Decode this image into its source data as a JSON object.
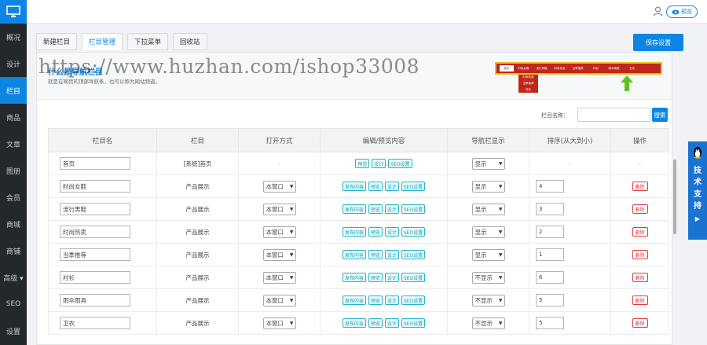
{
  "sidebar": {
    "logo_icon": "monitor-icon",
    "items": [
      {
        "label": "概况",
        "active": false
      },
      {
        "label": "设计",
        "active": false
      },
      {
        "label": "栏目",
        "active": true
      },
      {
        "label": "商品",
        "active": false
      },
      {
        "label": "文章",
        "active": false
      },
      {
        "label": "图册",
        "active": false
      },
      {
        "label": "会员",
        "active": false
      },
      {
        "label": "商城",
        "active": false
      },
      {
        "label": "商铺",
        "active": false
      },
      {
        "label": "高级 ▾",
        "active": false
      },
      {
        "label": "SEO",
        "active": false
      },
      {
        "label": "设置",
        "active": false
      }
    ]
  },
  "topbar": {
    "user_icon": "user-icon",
    "preview_label": "预览"
  },
  "tabs": [
    {
      "label": "新建栏目",
      "active": false
    },
    {
      "label": "栏目管理",
      "active": true
    },
    {
      "label": "下拉菜单",
      "active": false
    },
    {
      "label": "回收站",
      "active": false
    }
  ],
  "save_label": "保存设置",
  "info": {
    "title": "什么是导航栏目",
    "desc": "就是在网页的顶部导航条，也可以称为网站频道。",
    "watermark": "https://www.huzhan.com/ishop33008"
  },
  "nav_demo": {
    "items": [
      "首页",
      "时尚女鞋",
      "流行男鞋",
      "时尚热卖",
      "当季推荐",
      "衬衫",
      "雨伞雨具",
      "卫衣"
    ],
    "sub_items": [
      "时尚热卖",
      "当季推荐",
      "衬衫"
    ],
    "accent": "#c0271b",
    "arrow_color": "#5ec21e"
  },
  "search": {
    "label": "栏目名称：",
    "button": "搜索",
    "value": ""
  },
  "table": {
    "headers": [
      "栏目名",
      "栏目",
      "打开方式",
      "编辑/预览内容",
      "导航栏显示",
      "排序(从大到小)",
      "操作"
    ],
    "rows": [
      {
        "name": "首页",
        "type": "[系统]首页",
        "open": "-",
        "buttons": [
          "预览",
          "设计",
          "SEO设置"
        ],
        "nav": "显示",
        "order": "-",
        "action": "-"
      },
      {
        "name": "时尚女鞋",
        "type": "产品展示",
        "open": "本窗口",
        "buttons": [
          "发布内容",
          "预览",
          "设计",
          "SEO设置"
        ],
        "nav": "显示",
        "order": "4",
        "action": "删除"
      },
      {
        "name": "流行男鞋",
        "type": "产品展示",
        "open": "本窗口",
        "buttons": [
          "发布内容",
          "预览",
          "设计",
          "SEO设置"
        ],
        "nav": "显示",
        "order": "3",
        "action": "删除"
      },
      {
        "name": "时尚热卖",
        "type": "产品展示",
        "open": "本窗口",
        "buttons": [
          "发布内容",
          "预览",
          "设计",
          "SEO设置"
        ],
        "nav": "显示",
        "order": "2",
        "action": "删除"
      },
      {
        "name": "当季推荐",
        "type": "产品展示",
        "open": "本窗口",
        "buttons": [
          "发布内容",
          "预览",
          "设计",
          "SEO设置"
        ],
        "nav": "显示",
        "order": "1",
        "action": "删除"
      },
      {
        "name": "衬衫",
        "type": "产品展示",
        "open": "本窗口",
        "buttons": [
          "发布内容",
          "预览",
          "设计",
          "SEO设置"
        ],
        "nav": "不显示",
        "order": "6",
        "action": "删除"
      },
      {
        "name": "雨伞雨具",
        "type": "产品展示",
        "open": "本窗口",
        "buttons": [
          "发布内容",
          "预览",
          "设计",
          "SEO设置"
        ],
        "nav": "不显示",
        "order": "5",
        "action": "删除"
      },
      {
        "name": "卫衣",
        "type": "产品展示",
        "open": "本窗口",
        "buttons": [
          "发布内容",
          "预览",
          "设计",
          "SEO设置"
        ],
        "nav": "不显示",
        "order": "5",
        "action": "删除"
      }
    ]
  },
  "support": {
    "label": "技术支持",
    "icon": "qq-penguin-icon"
  },
  "colors": {
    "primary": "#0d86e3",
    "sidebar_bg": "#23282d",
    "danger": "#e0393e",
    "teal": "#26b4c8"
  }
}
